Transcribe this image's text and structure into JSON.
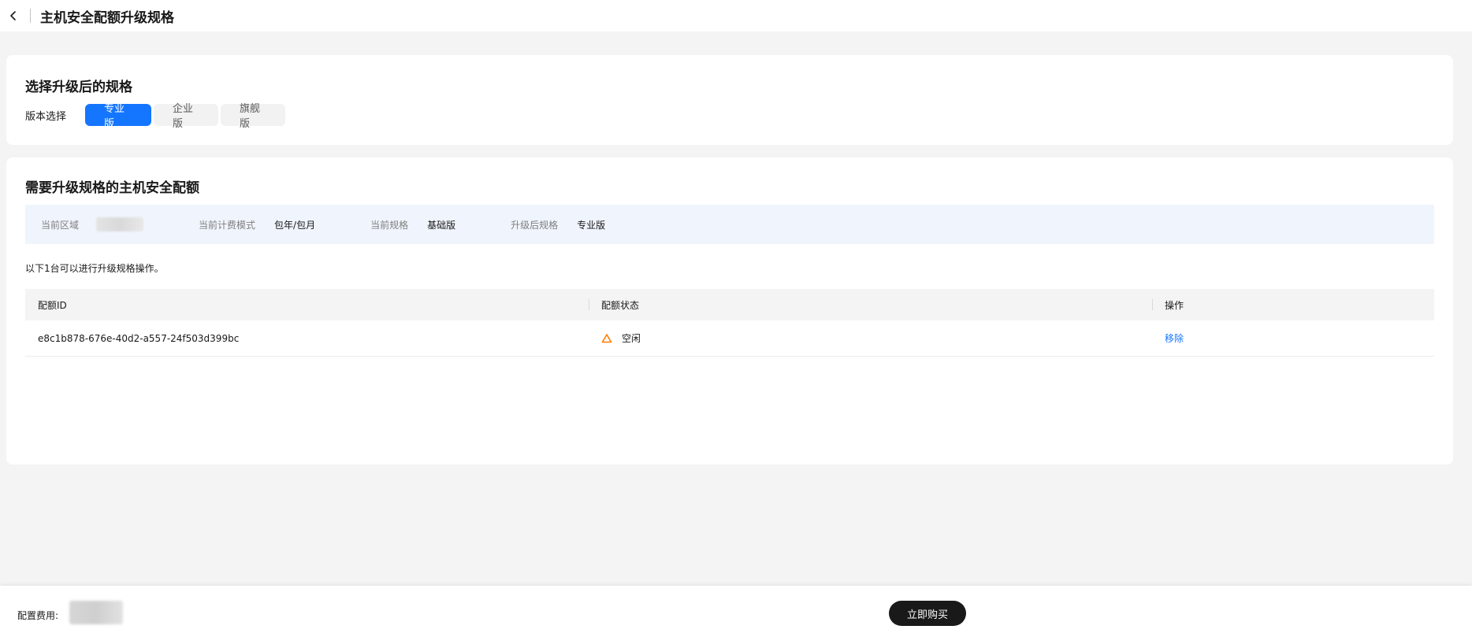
{
  "header": {
    "title": "主机安全配额升级规格"
  },
  "spec_card": {
    "title": "选择升级后的规格",
    "version_label": "版本选择",
    "versions": [
      {
        "label": "专业版",
        "selected": true
      },
      {
        "label": "企业版",
        "selected": false
      },
      {
        "label": "旗舰版",
        "selected": false
      }
    ]
  },
  "quota_card": {
    "title": "需要升级规格的主机安全配额",
    "info": {
      "region_label": "当前区域",
      "billing_label": "当前计费模式",
      "billing_value": "包年/包月",
      "current_spec_label": "当前规格",
      "current_spec_value": "基础版",
      "target_spec_label": "升级后规格",
      "target_spec_value": "专业版"
    },
    "note": "以下1台可以进行升级规格操作。",
    "table": {
      "columns": [
        "配额ID",
        "配额状态",
        "操作"
      ],
      "rows": [
        {
          "id": "e8c1b878-676e-40d2-a557-24f503d399bc",
          "status": "空闲",
          "action": "移除"
        }
      ]
    }
  },
  "footer": {
    "fee_label": "配置费用:",
    "buy_label": "立即购买"
  },
  "colors": {
    "primary": "#1476ff",
    "warning": "#ff7d00",
    "buy_button": "#191919"
  }
}
